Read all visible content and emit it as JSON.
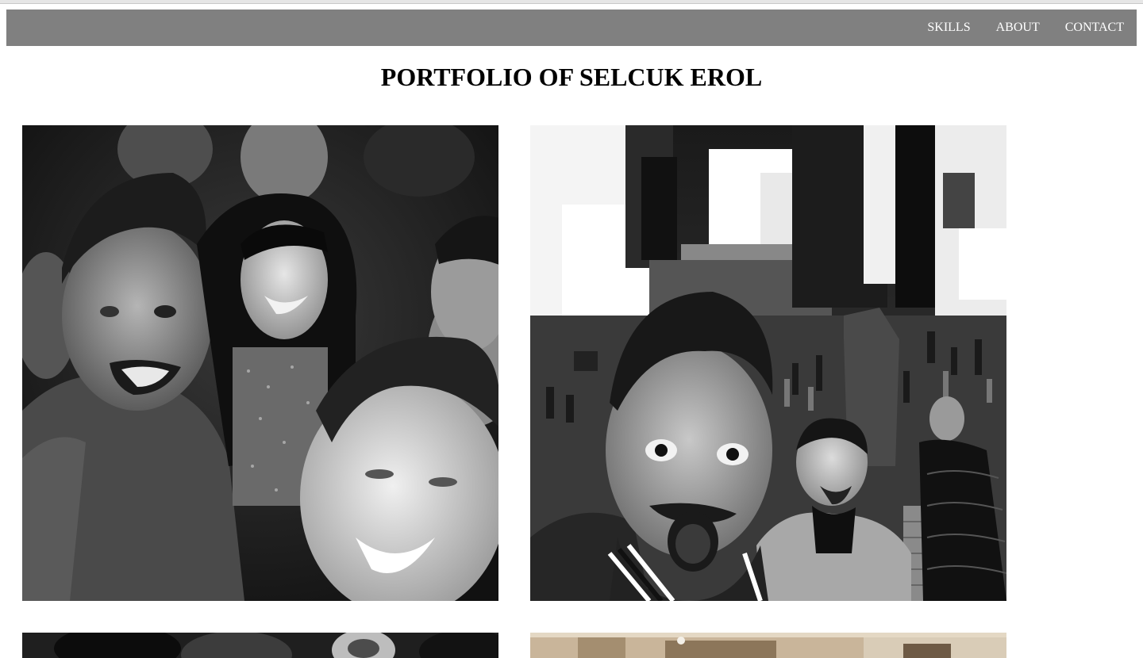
{
  "nav": {
    "links": [
      "SKILLS",
      "ABOUT",
      "CONTACT"
    ]
  },
  "page": {
    "title": "PORTFOLIO OF SELCUK EROL"
  },
  "gallery": {
    "photos": [
      {
        "subject": "party-selfie-crowd"
      },
      {
        "subject": "times-square-selfie"
      },
      {
        "subject": "crowd-partial"
      },
      {
        "subject": "interior-partial"
      }
    ]
  }
}
